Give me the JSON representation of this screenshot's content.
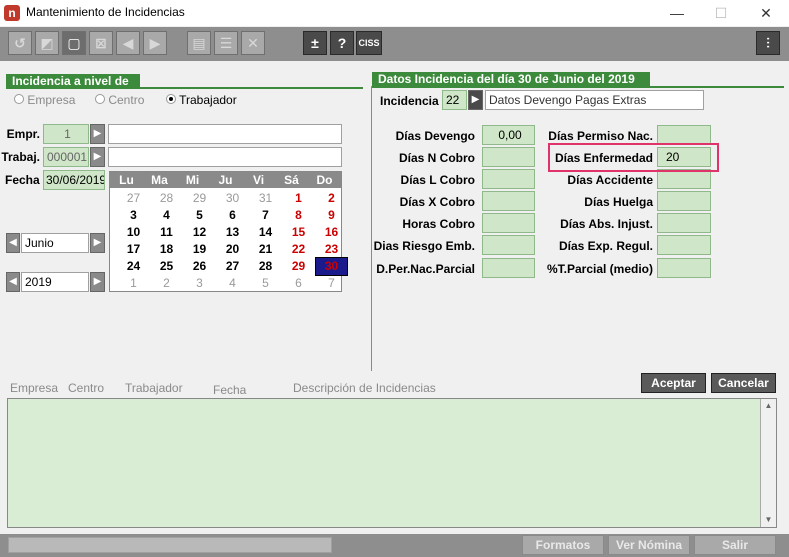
{
  "window": {
    "title": "Mantenimiento de Incidencias",
    "app_icon": "n"
  },
  "toolbar": {
    "ciss_label": "CISS",
    "help_label": "?",
    "plus_minus_label": "±"
  },
  "nivel": {
    "title": "Incidencia a nivel de",
    "options": [
      "Empresa",
      "Centro",
      "Trabajador"
    ],
    "selected": "Trabajador"
  },
  "left_form": {
    "empr_label": "Empr.",
    "empr_value": "1",
    "empr_name": "",
    "trabaj_label": "Trabaj.",
    "trabaj_value": "000001",
    "trabaj_name": "",
    "fecha_label": "Fecha",
    "fecha_value": "30/06/2019",
    "month_value": "Junio",
    "year_value": "2019"
  },
  "calendar": {
    "headers": [
      "Lu",
      "Ma",
      "Mi",
      "Ju",
      "Vi",
      "Sá",
      "Do"
    ],
    "weeks": [
      [
        "27",
        "28",
        "29",
        "30",
        "31",
        "1",
        "2"
      ],
      [
        "3",
        "4",
        "5",
        "6",
        "7",
        "8",
        "9"
      ],
      [
        "10",
        "11",
        "12",
        "13",
        "14",
        "15",
        "16"
      ],
      [
        "17",
        "18",
        "19",
        "20",
        "21",
        "22",
        "23"
      ],
      [
        "24",
        "25",
        "26",
        "27",
        "28",
        "29",
        "30"
      ],
      [
        "1",
        "2",
        "3",
        "4",
        "5",
        "6",
        "7"
      ]
    ]
  },
  "datos": {
    "title": "Datos Incidencia del día 30 de Junio del 2019",
    "incidencia_label": "Incidencia",
    "incidencia_code": "22",
    "incidencia_desc": "Datos Devengo Pagas Extras",
    "left_fields": [
      {
        "label": "Días Devengo",
        "value": "0,00"
      },
      {
        "label": "Días N Cobro",
        "value": ""
      },
      {
        "label": "Días L Cobro",
        "value": ""
      },
      {
        "label": "Días X Cobro",
        "value": ""
      },
      {
        "label": "Horas Cobro",
        "value": ""
      },
      {
        "label": "Dias Riesgo Emb.",
        "value": ""
      },
      {
        "label": "D.Per.Nac.Parcial",
        "value": ""
      }
    ],
    "right_fields": [
      {
        "label": "Días Permiso Nac.",
        "value": ""
      },
      {
        "label": "Días Enfermedad",
        "value": "20"
      },
      {
        "label": "Días Accidente",
        "value": ""
      },
      {
        "label": "Días Huelga",
        "value": ""
      },
      {
        "label": "Días Abs. Injust.",
        "value": ""
      },
      {
        "label": "Días Exp. Regul.",
        "value": ""
      },
      {
        "label": "%T.Parcial (medio)",
        "value": ""
      }
    ]
  },
  "actions": {
    "accept": "Aceptar",
    "cancel": "Cancelar"
  },
  "list": {
    "columns": [
      "Empresa",
      "Centro",
      "Trabajador",
      "Fecha",
      "Descripción de Incidencias"
    ]
  },
  "footer": {
    "formatos": "Formatos",
    "ver_nomina": "Ver Nómina",
    "salir": "Salir"
  },
  "colors": {
    "green_header": "#3c8a3c",
    "field_green": "#cfe6c8",
    "highlight": "#e0336a"
  }
}
